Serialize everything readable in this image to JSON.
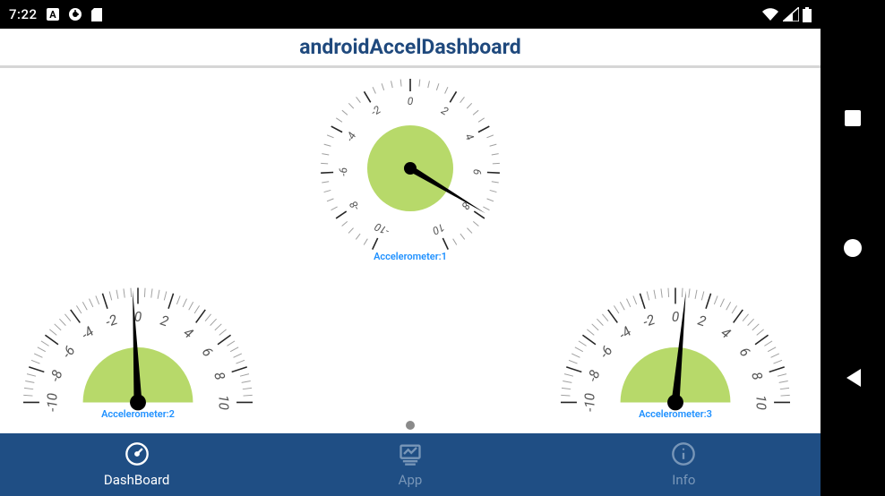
{
  "status": {
    "time": "7:22",
    "icons_left": [
      "a-icon",
      "clock-icon",
      "sd-icon"
    ],
    "icons_right": [
      "wifi-icon",
      "signal-icon",
      "battery-icon"
    ]
  },
  "header": {
    "title": "androidAccelDashboard"
  },
  "gauges": [
    {
      "label": "Accelerometer:1",
      "min": -10,
      "max": 10,
      "value": 7.8,
      "shape": "full",
      "start_angle": -245,
      "end_angle": 65
    },
    {
      "label": "Accelerometer:2",
      "min": -10,
      "max": 10,
      "value": -0.3,
      "shape": "half",
      "start_angle": -180,
      "end_angle": 0
    },
    {
      "label": "Accelerometer:3",
      "min": -10,
      "max": 10,
      "value": 0.6,
      "shape": "half",
      "start_angle": -180,
      "end_angle": 0
    }
  ],
  "nav": {
    "items": [
      {
        "label": "DashBoard",
        "icon": "gauge-icon",
        "active": true
      },
      {
        "label": "App",
        "icon": "chart-icon",
        "active": false
      },
      {
        "label": "Info",
        "icon": "info-icon",
        "active": false
      }
    ]
  },
  "colors": {
    "header_text": "#1f497d",
    "nav_bg": "#1f4e84",
    "nav_inactive": "#7896b8",
    "nav_active": "#ffffff",
    "gauge_fill": "#b7d96a",
    "gauge_label": "#1e90ff",
    "tick_major": "#252525",
    "tick_minor": "#a0a0a0",
    "needle": "#000000"
  },
  "chart_data": [
    {
      "type": "gauge",
      "title": "Accelerometer:1",
      "range": [
        -10,
        10
      ],
      "value": 7.8,
      "ticks_major": [
        -10,
        -8,
        -6,
        -4,
        -2,
        0,
        2,
        4,
        6,
        8,
        10
      ]
    },
    {
      "type": "gauge",
      "title": "Accelerometer:2",
      "range": [
        -10,
        10
      ],
      "value": -0.3,
      "ticks_major": [
        -10,
        -8,
        -6,
        -4,
        -2,
        0,
        2,
        4,
        6,
        8,
        10
      ]
    },
    {
      "type": "gauge",
      "title": "Accelerometer:3",
      "range": [
        -10,
        10
      ],
      "value": 0.6,
      "ticks_major": [
        -10,
        -8,
        -6,
        -4,
        -2,
        0,
        2,
        4,
        6,
        8,
        10
      ]
    }
  ]
}
